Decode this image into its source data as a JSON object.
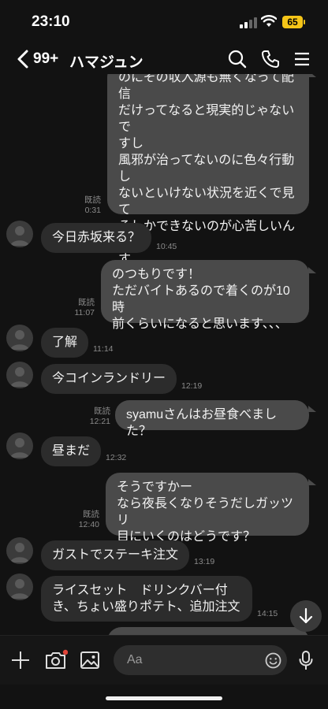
{
  "status": {
    "time": "23:10",
    "battery": "65"
  },
  "header": {
    "unread_count": "99+",
    "contact_name": "ハマジュン"
  },
  "messages": [
    {
      "dir": "out",
      "text": "のにその収入源も無くなって配信\nだけってなると現実的じゃないで\nすし\n風邪が治ってないのに色々行動し\nないといけない状況を近くで見て\nるしかできないのが心苦しいんで\nす、、\n一旦広島帰って調子整えた方がい\nいと思います😔",
      "read": "既読",
      "time": "0:31"
    },
    {
      "dir": "in",
      "text": "今日赤坂来る？",
      "time": "10:45"
    },
    {
      "dir": "out",
      "text": "のつもりです！\nただバイトあるので着くのが10時\n前くらいになると思います、、、",
      "read": "既読",
      "time": "11:07"
    },
    {
      "dir": "in",
      "text": "了解",
      "time": "11:14"
    },
    {
      "dir": "in",
      "text": "今コインランドリー",
      "time": "12:19"
    },
    {
      "dir": "out",
      "text": "syamuさんはお昼食べました？",
      "read": "既読",
      "time": "12:21"
    },
    {
      "dir": "in",
      "text": "昼まだ",
      "time": "12:32"
    },
    {
      "dir": "out",
      "text": "そうですかー\nなら夜長くなりそうだしガッツリ\n目にいくのはどうです？",
      "read": "既読",
      "time": "12:40"
    },
    {
      "dir": "in",
      "text": "ガストでステーキ注文",
      "time": "13:19"
    },
    {
      "dir": "in",
      "text": "ライスセット　ドリンクバー付\nき、ちょい盛りポテト、追加注文",
      "time": "14:15"
    }
  ],
  "input": {
    "placeholder": "Aa"
  },
  "icons": {
    "back": "chevron-left-icon",
    "search": "search-icon",
    "call": "phone-icon",
    "menu": "menu-icon",
    "plus": "plus-icon",
    "camera": "camera-icon",
    "image": "image-icon",
    "emoji": "emoji-icon",
    "mic": "microphone-icon",
    "scroll": "arrow-down-icon"
  },
  "colors": {
    "background": "#121212",
    "incoming_bubble": "#2c2c2c",
    "outgoing_bubble": "#4a4a4a",
    "battery": "#f5c518",
    "camera_dot": "#e0453a"
  }
}
